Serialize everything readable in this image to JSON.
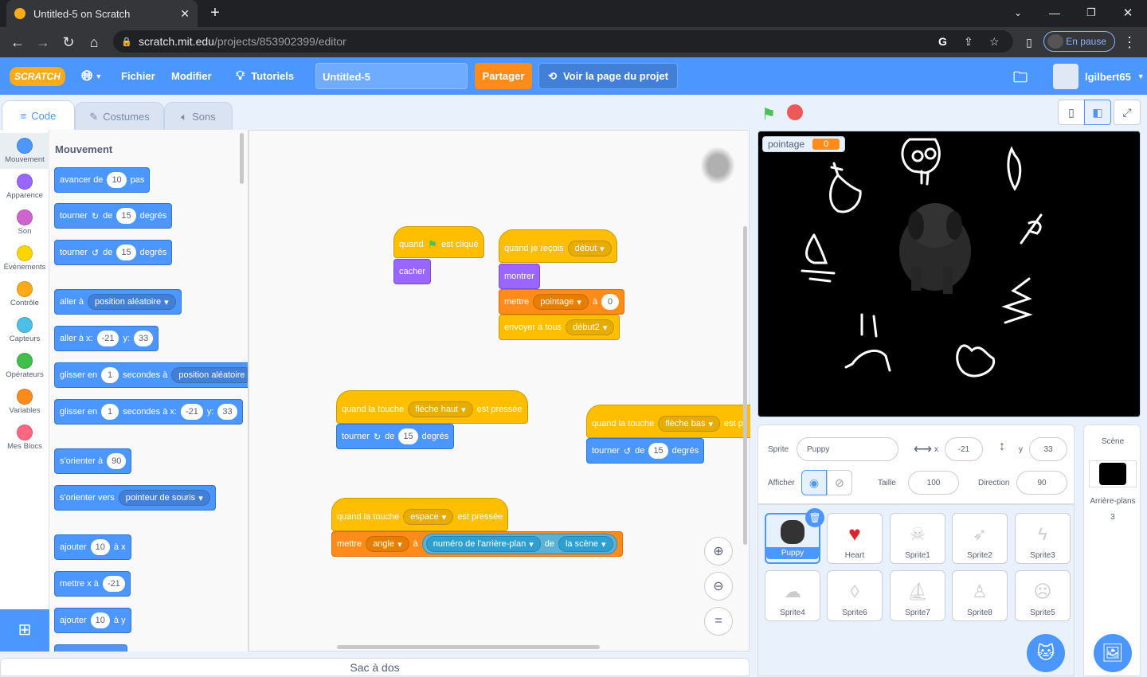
{
  "browser": {
    "tab_title": "Untitled-5 on Scratch",
    "url_domain": "scratch.mit.edu",
    "url_path": "/projects/853902399/editor",
    "profile_status": "En pause"
  },
  "menu": {
    "logo": "SCRATCH",
    "file": "Fichier",
    "edit": "Modifier",
    "tutorials": "Tutoriels",
    "project_title": "Untitled-5",
    "share": "Partager",
    "see_project_page": "Voir la page du projet",
    "username": "lgilbert65"
  },
  "tabs": {
    "code": "Code",
    "costumes": "Costumes",
    "sounds": "Sons"
  },
  "categories": [
    {
      "label": "Mouvement",
      "color": "#4c97ff"
    },
    {
      "label": "Apparence",
      "color": "#9966ff"
    },
    {
      "label": "Son",
      "color": "#cf63cf"
    },
    {
      "label": "Événements",
      "color": "#ffd500"
    },
    {
      "label": "Contrôle",
      "color": "#ffab19"
    },
    {
      "label": "Capteurs",
      "color": "#4cbfe6"
    },
    {
      "label": "Opérateurs",
      "color": "#40bf4a"
    },
    {
      "label": "Variables",
      "color": "#ff8c1a"
    },
    {
      "label": "Mes Blocs",
      "color": "#ff6680"
    }
  ],
  "palette": {
    "heading": "Mouvement",
    "move_a": "avancer de",
    "move_n": "10",
    "move_b": "pas",
    "turn_a": "tourner",
    "turn_de": "de",
    "turn_n": "15",
    "turn_b": "degrés",
    "goto_a": "aller à",
    "goto_opt": "position aléatoire",
    "gotoxy_a": "aller à x:",
    "x_val": "-21",
    "y_lbl": "y:",
    "y_val": "33",
    "glide_a": "glisser en",
    "glide_n": "1",
    "glide_b": "secondes à",
    "glide_opt": "position aléatoire",
    "glide_b2": "secondes à x:",
    "point_a": "s'orienter à",
    "point_n": "90",
    "pointto_a": "s'orienter vers",
    "pointto_opt": "pointeur de souris",
    "changex_a": "ajouter",
    "changex_n": "10",
    "changex_b": "à x",
    "setx_a": "mettre x à",
    "setx_n": "-21",
    "changey_b": "à y"
  },
  "scripts": {
    "flag_quand": "quand",
    "flag_clicked": "est cliqué",
    "hide": "cacher",
    "recv": "quand je reçois",
    "recv_opt": "début",
    "show": "montrer",
    "set": "mettre",
    "set_var": "pointage",
    "set_to": "à",
    "set_val": "0",
    "broadcast": "envoyer à tous",
    "broadcast_opt": "début2",
    "key_when": "quand la touche",
    "key_pressed": "est pressée",
    "key_up": "flèche haut",
    "key_down": "flèche bas",
    "key_space": "espace",
    "turn": "tourner",
    "de": "de",
    "turn_n": "15",
    "degrees": "degrés",
    "set_angle_var": "angle",
    "backdrop_num": "numéro de l'arrière-plan",
    "of": "de",
    "stage_opt": "la scène",
    "est_pr": "est pr"
  },
  "backpack": "Sac à dos",
  "stage": {
    "var_name": "pointage",
    "var_value": "0"
  },
  "sprite_info": {
    "sprite_lbl": "Sprite",
    "sprite_name": "Puppy",
    "x_lbl": "x",
    "x_val": "-21",
    "y_lbl": "y",
    "y_val": "33",
    "show_lbl": "Afficher",
    "size_lbl": "Taille",
    "size_val": "100",
    "dir_lbl": "Direction",
    "dir_val": "90"
  },
  "sprites": [
    "Puppy",
    "Heart",
    "Sprite1",
    "Sprite2",
    "Sprite3",
    "Sprite4",
    "Sprite6",
    "Sprite7",
    "Sprite8",
    "Sprite5"
  ],
  "scene": {
    "title": "Scène",
    "backdrops_lbl": "Arrière-plans",
    "backdrops_count": "3"
  }
}
